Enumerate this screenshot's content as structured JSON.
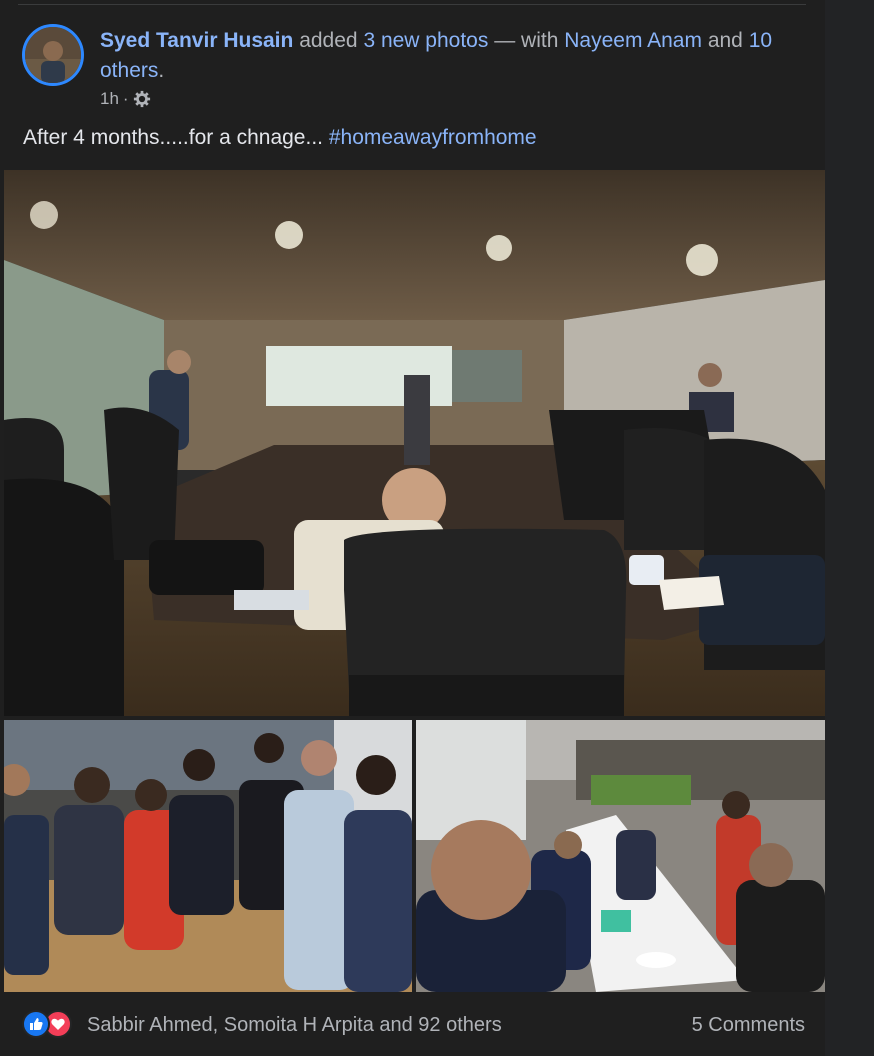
{
  "post": {
    "author": "Syed Tanvir Husain",
    "action_text": "added",
    "photos_link": "3 new photos",
    "with_text": "— with",
    "tagged_person": "Nayeem Anam",
    "and_text": "and",
    "others_link": "10 others",
    "period": ".",
    "timestamp": "1h",
    "separator": "·",
    "caption_text": "After 4 months.....for a chnage...",
    "hashtag": "#homeawayfromhome"
  },
  "footer": {
    "reaction_names": "Sabbir Ahmed, Somoita H Arpita and 92 others",
    "comments": "5 Comments",
    "reaction_icons": [
      "like-icon",
      "love-icon"
    ]
  },
  "colors": {
    "link": "#8ab4f8",
    "like": "#1877f2",
    "love": "#f33e58",
    "avatar_ring": "#2d88ff"
  }
}
